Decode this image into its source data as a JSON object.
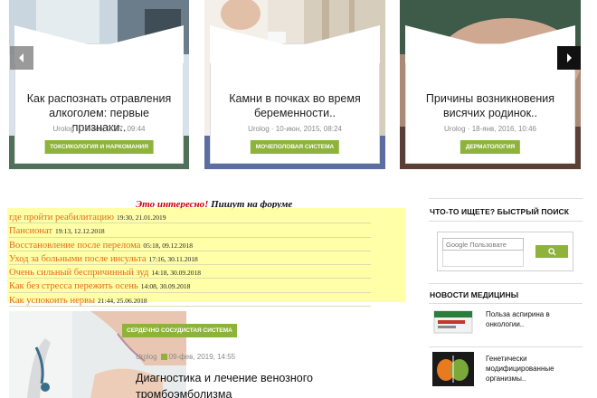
{
  "slider": {
    "slides": [
      {
        "title": "Как распознать отравления алкоголем: первые признаки..",
        "author": "Urolog",
        "date": "10-янв, 2017, 09:44",
        "category": "ТОКСИКОЛОГИЯ И НАРКОМАНИЯ"
      },
      {
        "title": "Камни в почках во время беременности..",
        "author": "Urolog",
        "date": "10-июн, 2015, 08:24",
        "category": "МОЧЕПОЛОВАЯ СИСТЕМА"
      },
      {
        "title": "Причины возникновения висячих родинок..",
        "author": "Urolog",
        "date": "18-янв, 2016, 10:46",
        "category": "ДЕРМАТОЛОГИЯ"
      }
    ],
    "prev_icon": "chevron-left-icon",
    "next_icon": "chevron-right-icon"
  },
  "forum": {
    "heading_red": "Это интересно!",
    "heading_dark": "Пишут на форуме",
    "items": [
      {
        "text": "где пройти реабилитацию",
        "date": "19:30, 21.01.2019"
      },
      {
        "text": "Пансионат",
        "date": "19:13, 12.12.2018"
      },
      {
        "text": "Восстановление после перелома",
        "date": "05:18, 09.12.2018"
      },
      {
        "text": "Уход за больными после инсульта",
        "date": "17:16, 30.11.2018"
      },
      {
        "text": "Очень сильный беспричинный зуд",
        "date": "14:18, 30.09.2018"
      },
      {
        "text": "Как без стресса пережить осень",
        "date": "14:08, 30.09.2018"
      },
      {
        "text": "Как успокоить нервы",
        "date": "21:44, 25.06.2018"
      }
    ]
  },
  "article": {
    "category": "СЕРДЕЧНО СОСУДИСТАЯ СИСТЕМА",
    "author": "Urolog",
    "date": "09-фев, 2019, 14:55",
    "title": "Диагностика и лечение венозного тромбоэмболизма"
  },
  "sidebar": {
    "search_heading": "ЧТО-ТО ИЩЕТЕ? БЫСТРЫЙ ПОИСК",
    "search_placeholder": "Google Пользовате",
    "search_icon": "search-icon",
    "news_heading": "НОВОСТИ МЕДИЦИНЫ",
    "news": [
      {
        "title": "Польза аспирина в онкологии.."
      },
      {
        "title": "Генетически модифицированные организмы.."
      }
    ]
  },
  "colors": {
    "accent": "#8db33a",
    "forum_link": "#e46a1b",
    "forum_bg": "#ffff99",
    "heading_red": "#d00000"
  }
}
